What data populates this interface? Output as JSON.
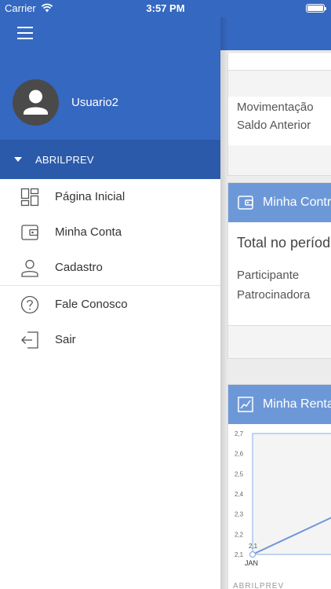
{
  "status_bar": {
    "carrier": "Carrier",
    "time": "3:57 PM"
  },
  "drawer": {
    "username": "Usuario2",
    "organization": "ABRILPREV",
    "menu": [
      {
        "label": "Página Inicial",
        "icon": "dashboard-icon"
      },
      {
        "label": "Minha Conta",
        "icon": "wallet-icon"
      },
      {
        "label": "Cadastro",
        "icon": "person-icon"
      },
      {
        "label": "Fale Conosco",
        "icon": "help-icon"
      },
      {
        "label": "Sair",
        "icon": "exit-icon"
      }
    ]
  },
  "background": {
    "card1": {
      "row1": "Movimentação",
      "row2": "Saldo Anterior"
    },
    "card2": {
      "title": "Minha Contr",
      "total": "Total no períod",
      "row1": "Participante",
      "row2": "Patrocinadora"
    },
    "card3": {
      "title": "Minha Renta"
    },
    "footer": "ABRILPREV"
  },
  "colors": {
    "primary": "#3568c0",
    "primary_dark": "#2b5aaa",
    "card_header": "#6d98d8"
  },
  "chart_data": {
    "type": "line",
    "categories": [
      "JAN"
    ],
    "values": [
      2.1
    ],
    "point_labels": [
      "2,1"
    ],
    "yticks": [
      "2,7",
      "2,6",
      "2,5",
      "2,4",
      "2,3",
      "2,2",
      "2,1"
    ],
    "ylim": [
      2.1,
      2.7
    ]
  }
}
